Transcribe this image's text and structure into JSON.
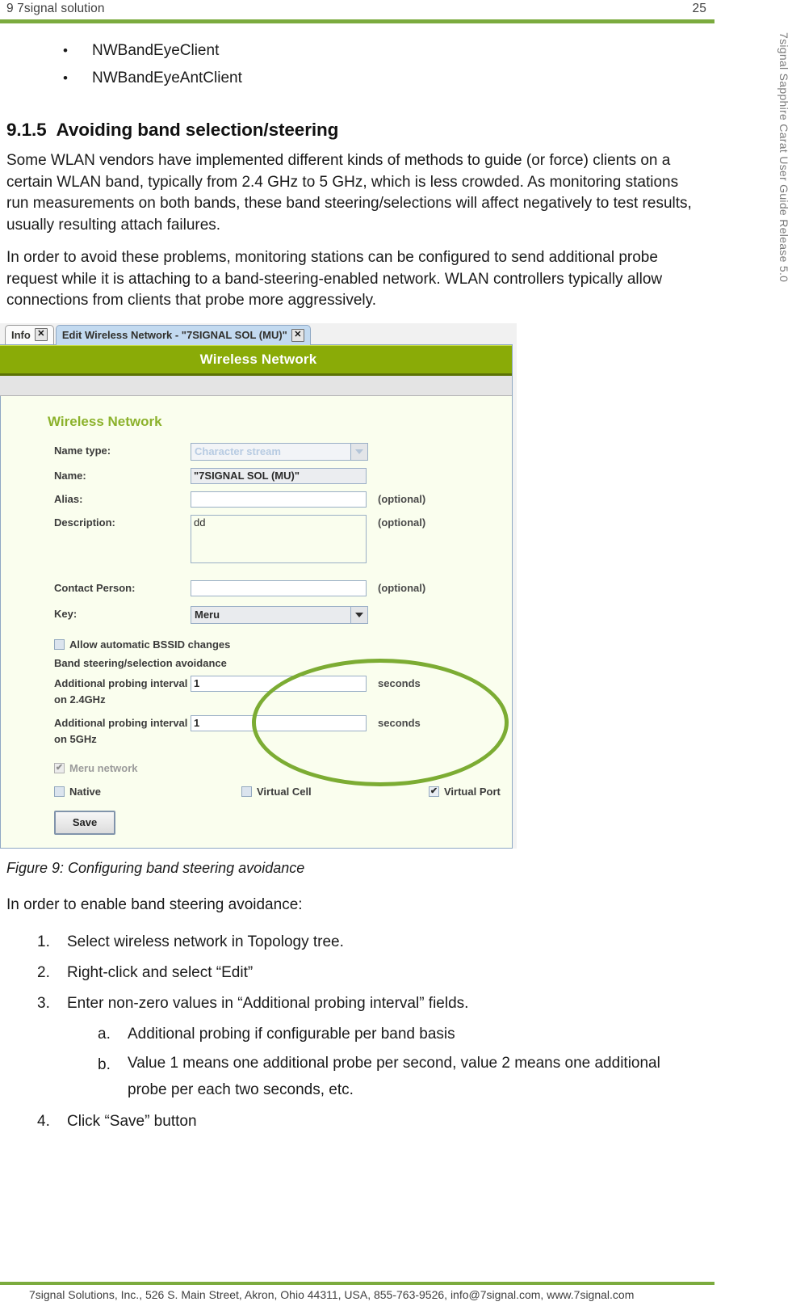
{
  "header": {
    "left_text": "9 7signal solution",
    "page_number": "25"
  },
  "side_title": "7signal Sapphire Carat User Guide Release 5.0",
  "bullets": [
    "NWBandEyeClient",
    "NWBandEyeAntClient"
  ],
  "heading": {
    "number": "9.1.5",
    "text": "Avoiding band selection/steering"
  },
  "paragraphs": [
    "Some WLAN vendors have implemented different kinds of methods to guide (or force) clients on a certain WLAN band, typically from 2.4 GHz to 5 GHz, which is less crowded. As monitoring stations run measurements on both bands, these band steering/selections will affect negatively to test results, usually resulting attach failures.",
    "In order to avoid these problems, monitoring stations can be configured to send additional probe request while it is attaching to a band-steering-enabled network. WLAN controllers typically allow connections from clients that probe more aggressively."
  ],
  "figure": {
    "tabs": [
      {
        "label": "Info",
        "close": "✕",
        "active": false
      },
      {
        "label": "Edit Wireless Network - \"7SIGNAL SOL (MU)\"",
        "close": "✕",
        "active": true
      }
    ],
    "window_title": "Wireless Network",
    "form_heading": "Wireless Network",
    "fields": {
      "name_type": {
        "label": "Name type:",
        "value": "Character stream",
        "disabled": true
      },
      "name": {
        "label": "Name:",
        "value": "\"7SIGNAL SOL (MU)\"",
        "readonly": true
      },
      "alias": {
        "label": "Alias:",
        "value": "",
        "suffix": "(optional)"
      },
      "description": {
        "label": "Description:",
        "value": "dd",
        "suffix": "(optional)"
      },
      "contact_person": {
        "label": "Contact Person:",
        "value": "",
        "suffix": "(optional)"
      },
      "key": {
        "label": "Key:",
        "value": "Meru"
      }
    },
    "checkboxes": {
      "allow_bssid": {
        "label": "Allow automatic BSSID changes",
        "checked": false
      },
      "meru_network": {
        "label": "Meru network",
        "checked": true,
        "disabled": true
      },
      "native": {
        "label": "Native",
        "checked": false
      },
      "virtual_cell": {
        "label": "Virtual Cell",
        "checked": false
      },
      "virtual_port": {
        "label": "Virtual Port",
        "checked": true
      }
    },
    "band_steering": {
      "group_label": "Band steering/selection avoidance",
      "probe_24": {
        "label": "Additional probing interval on 2.4GHz",
        "value": "1",
        "unit": "seconds"
      },
      "probe_5": {
        "label": "Additional probing interval on 5GHz",
        "value": "1",
        "unit": "seconds"
      }
    },
    "save_button": "Save",
    "check_glyph": "✔",
    "highlight_color": "#7cac33",
    "title_bar_color": "#8aab07"
  },
  "caption": "Figure 9: Configuring band steering avoidance",
  "intro_line": "In order to enable band steering avoidance:",
  "steps": [
    {
      "marker": "1.",
      "text": "Select wireless network in Topology tree."
    },
    {
      "marker": "2.",
      "text": "Right-click and select “Edit”"
    },
    {
      "marker": "3.",
      "text": "Enter non-zero values in “Additional probing interval” fields."
    },
    {
      "marker": "4.",
      "text": "Click “Save” button"
    }
  ],
  "substeps": [
    {
      "marker": "a.",
      "text": "Additional probing if configurable per band basis"
    },
    {
      "marker": "b.",
      "line1": "Value 1 means one additional probe per second, value 2 means one additional",
      "line2": "probe per each two seconds, etc."
    }
  ],
  "footer": {
    "text": "7signal Solutions, Inc., 526 S. Main Street, Akron, Ohio 44311, USA, 855-763-9526, info@7signal.com, www.7signal.com"
  }
}
